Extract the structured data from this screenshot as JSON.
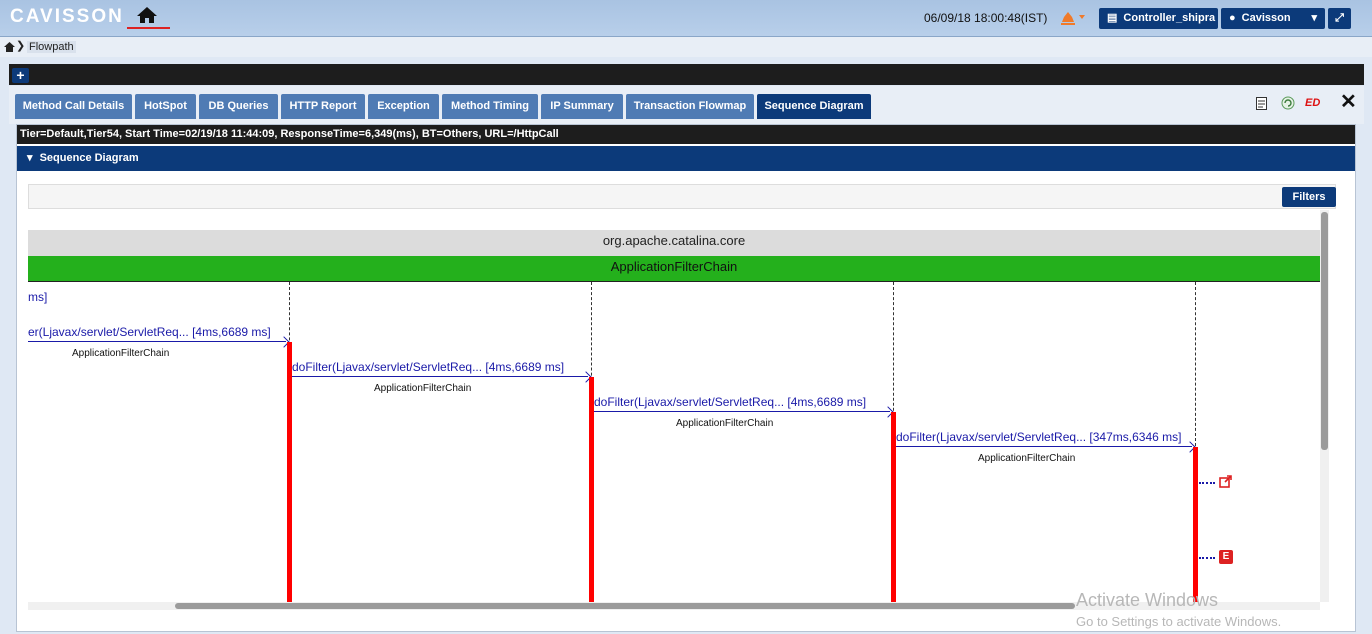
{
  "app": {
    "logo": "CAVISSON",
    "datetime": "06/09/18 18:00:48(IST)",
    "controller": "Controller_shipra",
    "user": "Cavisson"
  },
  "breadcrumb": {
    "label": "Flowpath"
  },
  "tabs": [
    {
      "label": "Method Call Details"
    },
    {
      "label": "HotSpot"
    },
    {
      "label": "DB Queries"
    },
    {
      "label": "HTTP Report"
    },
    {
      "label": "Exception"
    },
    {
      "label": "Method Timing"
    },
    {
      "label": "IP Summary"
    },
    {
      "label": "Transaction Flowmap"
    },
    {
      "label": "Sequence Diagram",
      "active": true
    }
  ],
  "toolbar_icons": {
    "ed": "ED"
  },
  "info": "Tier=Default,Tier54, Start Time=02/19/18 11:44:09, ResponseTime=6,349(ms), BT=Others, URL=/HttpCall",
  "section": {
    "title": "Sequence Diagram"
  },
  "filters": {
    "label": "Filters"
  },
  "diagram": {
    "package": "org.apache.catalina.core",
    "class": "ApplicationFilterChain",
    "top_label": "ms]",
    "calls": [
      {
        "label": "er(Ljavax/servlet/ServletReq...   [4ms,6689 ms]",
        "caller": "ApplicationFilterChain"
      },
      {
        "label": "doFilter(Ljavax/servlet/ServletReq...   [4ms,6689 ms]",
        "caller": "ApplicationFilterChain"
      },
      {
        "label": "doFilter(Ljavax/servlet/ServletReq...   [4ms,6689 ms]",
        "caller": "ApplicationFilterChain"
      },
      {
        "label": "doFilter(Ljavax/servlet/ServletReq...   [347ms,6346 ms]",
        "caller": "ApplicationFilterChain"
      }
    ],
    "exception_badge": "E"
  },
  "watermark": {
    "line1": "Activate Windows",
    "line2": "Go to Settings to activate Windows."
  },
  "colors": {
    "nav_dark": "#0c3a7a",
    "tab": "#4f7bb4",
    "activation": "#ff0000",
    "class_bar": "#24b01c",
    "call_text": "#1a1aa8"
  }
}
